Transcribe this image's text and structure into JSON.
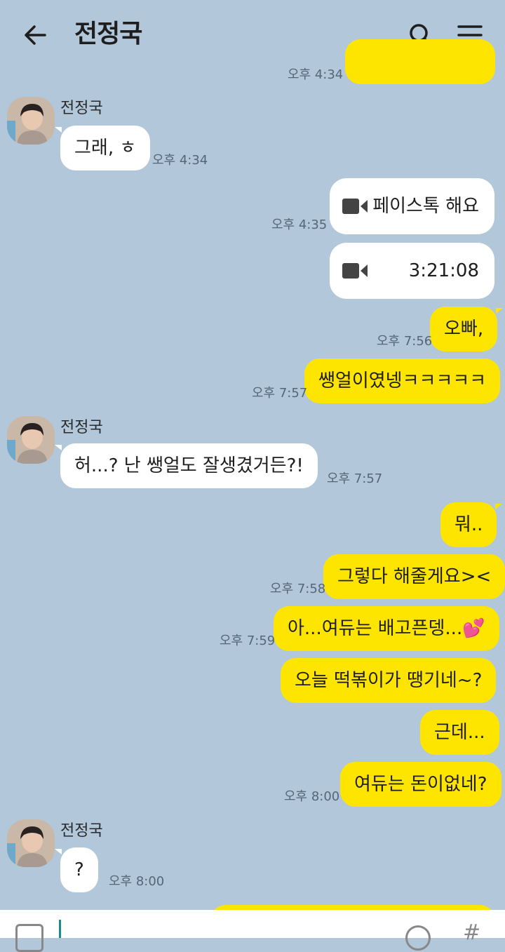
{
  "header": {
    "title": "전정국",
    "back_icon": "arrow-left-icon",
    "search_icon": "search-icon",
    "menu_icon": "menu-icon"
  },
  "colors": {
    "background": "#b2c7d9",
    "my_bubble": "#fee500",
    "other_bubble": "#ffffff"
  },
  "messages": [
    {
      "from": "me",
      "text": "",
      "time": "오후 4:34"
    },
    {
      "from": "other",
      "sender": "전정국",
      "text": "그래, ㅎ",
      "time": "오후 4:34"
    },
    {
      "from": "me",
      "type": "call",
      "text": "페이스톡 해요",
      "time": "오후 4:35"
    },
    {
      "from": "me",
      "type": "call",
      "text": "3:21:08",
      "time": ""
    },
    {
      "from": "me",
      "text": "오빠,",
      "time": "오후 7:56"
    },
    {
      "from": "me",
      "text": "쌩얼이였넹ㅋㅋㅋㅋㅋ",
      "time": "오후 7:57"
    },
    {
      "from": "other",
      "sender": "전정국",
      "text": "허...? 난 쌩얼도 잘생겼거든?!",
      "time": "오후 7:57"
    },
    {
      "from": "me",
      "text": "뭐..",
      "time": ""
    },
    {
      "from": "me",
      "text": "그렇다 해줄게요><",
      "time": "오후 7:58"
    },
    {
      "from": "me",
      "text": "아...여듀는 배고픈뎅...💕",
      "time": "오후 7:59"
    },
    {
      "from": "me",
      "text": "오늘 떡볶이가 땡기네~?",
      "time": ""
    },
    {
      "from": "me",
      "text": "근데...",
      "time": ""
    },
    {
      "from": "me",
      "text": "여듀는 돈이없네?",
      "time": "오후 8:00"
    },
    {
      "from": "other",
      "sender": "전정국",
      "text": "?",
      "time": "오후 8:00"
    }
  ],
  "input": {
    "attach_icon": "plus-icon",
    "emoji_icon": "emoji-icon",
    "hash_icon": "hash-icon",
    "hash_glyph": "#"
  }
}
